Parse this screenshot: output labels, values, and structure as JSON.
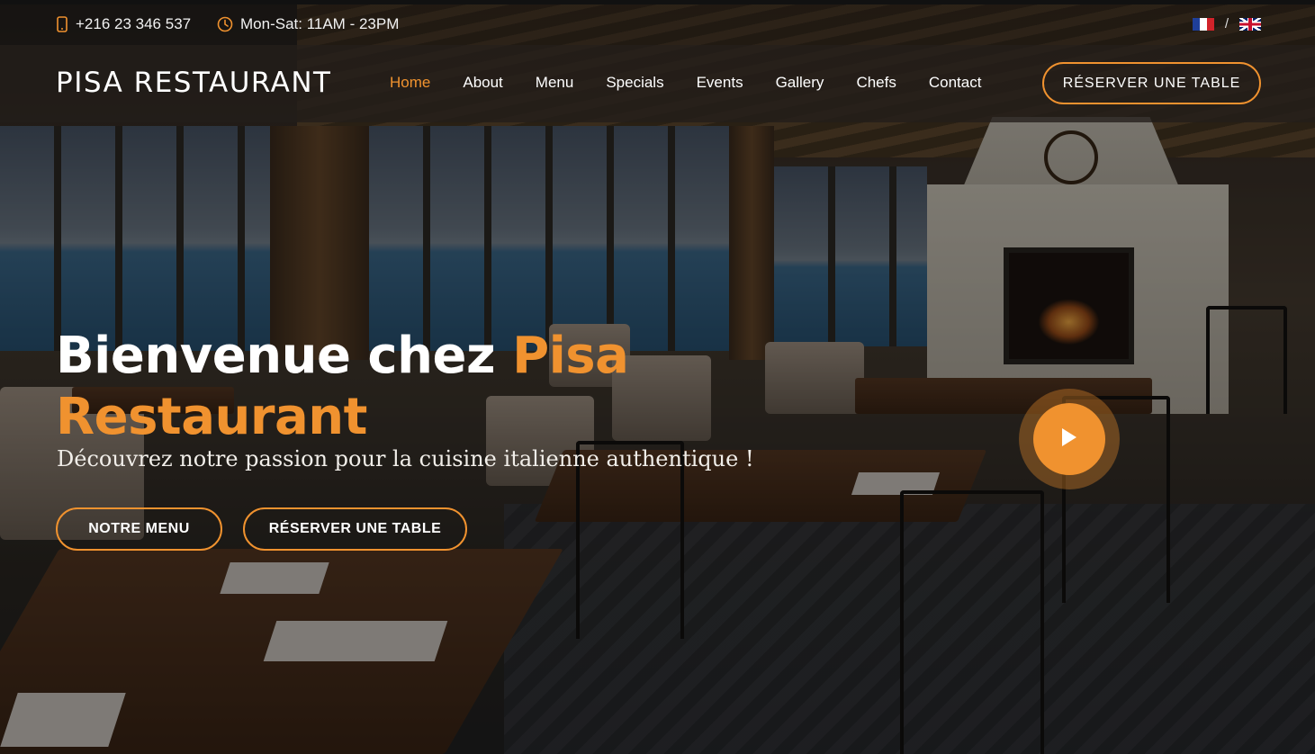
{
  "topbar": {
    "phone": "+216 23 346 537",
    "hours": "Mon-Sat: 11AM - 23PM",
    "lang_separator": "/",
    "languages": [
      {
        "code": "fr",
        "icon": "france-flag-icon"
      },
      {
        "code": "en",
        "icon": "uk-flag-icon"
      }
    ]
  },
  "header": {
    "logo": "PISA RESTAURANT",
    "nav": [
      {
        "label": "Home",
        "active": true
      },
      {
        "label": "About"
      },
      {
        "label": "Menu"
      },
      {
        "label": "Specials"
      },
      {
        "label": "Events"
      },
      {
        "label": "Gallery"
      },
      {
        "label": "Chefs"
      },
      {
        "label": "Contact"
      }
    ],
    "cta": "RÉSERVER UNE TABLE"
  },
  "hero": {
    "title_part1": "Bienvenue chez ",
    "title_accent": "Pisa Restaurant",
    "subtitle": "Découvrez notre passion pour la cuisine italienne authentique !",
    "btn_menu": "NOTRE MENU",
    "btn_reserve": "RÉSERVER UNE TABLE",
    "play_icon": "play-icon"
  },
  "colors": {
    "accent": "#f0922f",
    "header_bg": "#221e1a",
    "text": "#ffffff"
  }
}
